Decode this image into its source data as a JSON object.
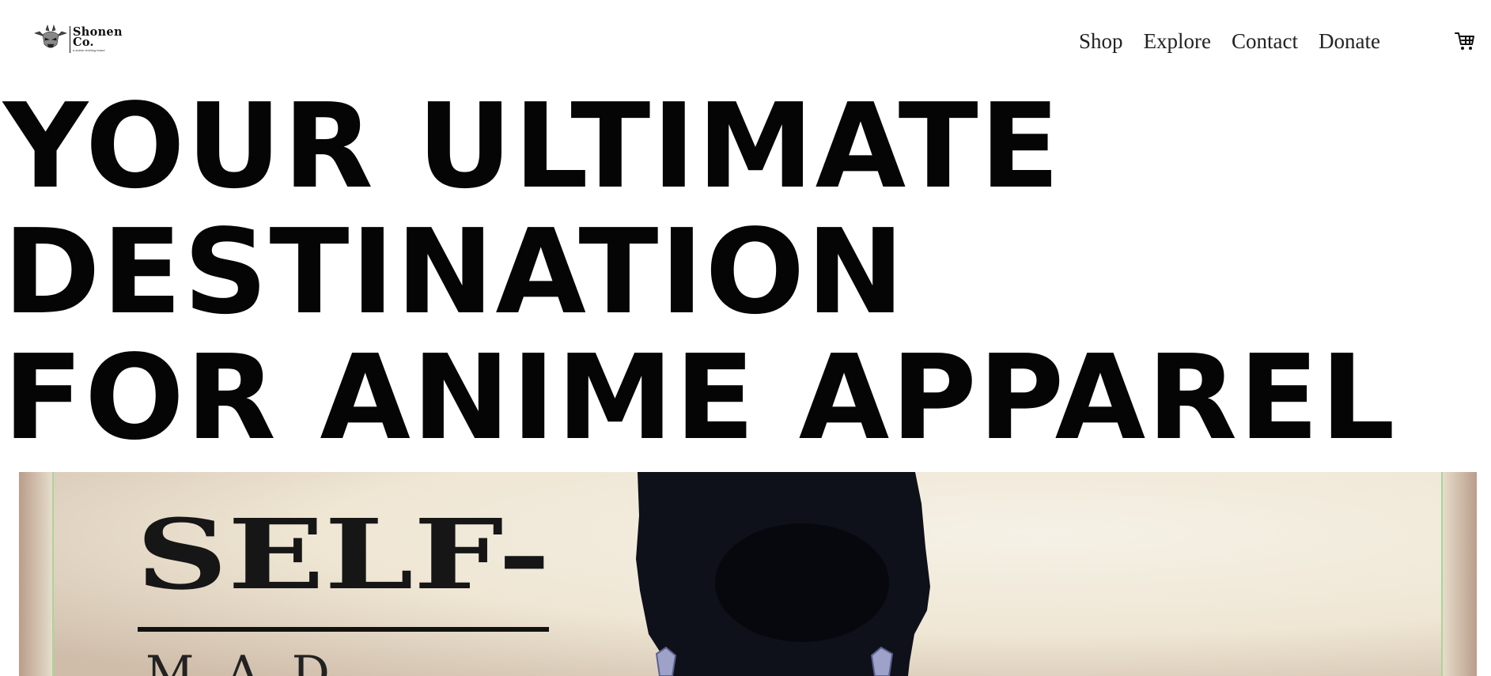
{
  "brand": {
    "name_line1": "Shonen",
    "name_line2": "Co.",
    "tagline": "a anime clothing brand",
    "icon": "demon-mask-logo-icon"
  },
  "nav": {
    "items": [
      {
        "label": "Shop"
      },
      {
        "label": "Explore"
      },
      {
        "label": "Contact"
      },
      {
        "label": "Donate"
      }
    ],
    "cart_icon": "shopping-cart-icon"
  },
  "hero": {
    "title_lines": [
      "YOUR ULTIMATE",
      "DESTINATION",
      "FOR ANIME APPAREL"
    ],
    "image": {
      "text": "SELF-",
      "subtext_partial": "M A D E",
      "description_icon": "hero-banner-image"
    }
  },
  "colors": {
    "text": "#050505",
    "background": "#ffffff",
    "banner_cream": "#f2ead9",
    "banner_border": "#a9d59a"
  }
}
